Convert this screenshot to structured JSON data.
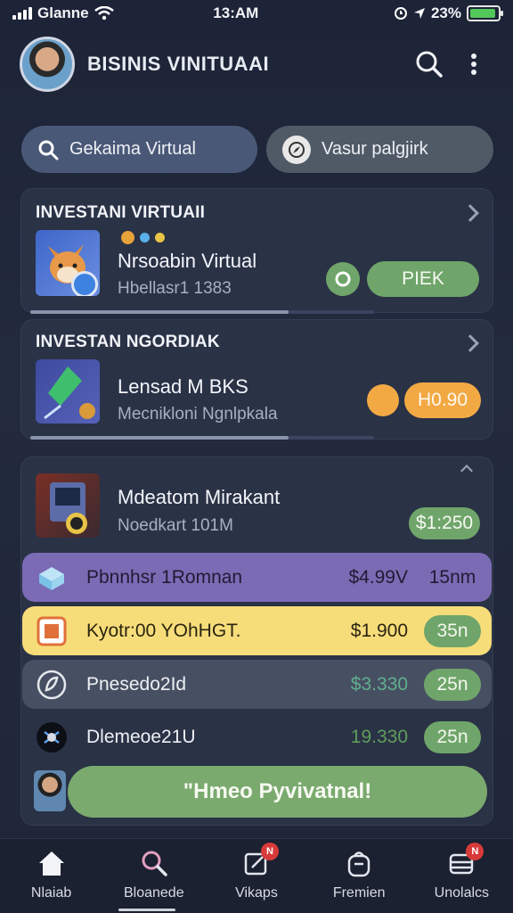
{
  "status_bar": {
    "carrier": "Glanne",
    "time": "13:AM",
    "battery": "23%",
    "battery_level": 0.95
  },
  "header": {
    "title": "BISINIS VINITUAAI"
  },
  "search": {
    "label": "Gekaima Virtual"
  },
  "filter": {
    "label": "Vasur palgjirk"
  },
  "card1": {
    "title": "INVESTANI VIRTUAII",
    "item_name": "Nrsoabin Virtual",
    "item_sub": "Hbellasr1 1383",
    "button": "PIEK",
    "progress": 0.75
  },
  "card2": {
    "title": "INVESTAN NGORDIAK",
    "item_name": "Lensad M BKS",
    "item_sub": "Mecnikloni Ngnlpkala",
    "button": "H0.90",
    "progress": 0.75
  },
  "card3": {
    "item_name": "Mdeatom Mirakant",
    "item_sub": "Noedkart 101M",
    "button": "$1:250"
  },
  "rows": [
    {
      "label": "Pbnnhsr 1Romnan",
      "price": "$4.99V",
      "time": "15nm",
      "bg": "#7b6bb5",
      "text": "#1f1c33"
    },
    {
      "label": "Kyotr:00 YOhHGT.",
      "price": "$1.900",
      "time": "35n",
      "bg": "#f7dd7a",
      "text": "#2a2410"
    },
    {
      "label": "Pnesedo2Id",
      "price": "$3.330",
      "time": "25n",
      "bg": "#475062",
      "text": "#eef0f5"
    },
    {
      "label": "Dlemeoe21U",
      "price": "19.330",
      "time": "25n",
      "bg": "#2a3246",
      "text": "#eef0f5"
    }
  ],
  "cta": {
    "label": "\"Hmeo Pyvivatnal!"
  },
  "tabs": [
    {
      "label": "Nlaiab",
      "icon": "home-icon"
    },
    {
      "label": "Bloanede",
      "icon": "search-icon"
    },
    {
      "label": "Vikaps",
      "icon": "edit-icon",
      "badge": "N"
    },
    {
      "label": "Fremien",
      "icon": "bag-icon"
    },
    {
      "label": "Unolalcs",
      "icon": "stack-icon",
      "badge": "N"
    }
  ],
  "colors": {
    "accent_green": "#6fa56a",
    "accent_orange": "#f2a944",
    "background": "#1f2638"
  }
}
